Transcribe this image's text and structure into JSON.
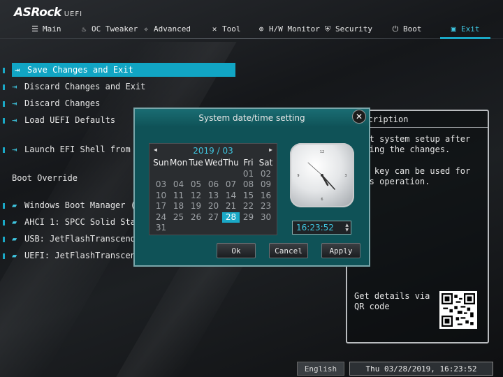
{
  "brand": {
    "name": "ASRock",
    "suffix": "UEFI"
  },
  "nav": {
    "items": [
      {
        "label": "Main",
        "icon": "list-icon"
      },
      {
        "label": "OC Tweaker",
        "icon": "flame-icon"
      },
      {
        "label": "Advanced",
        "icon": "star-icon"
      },
      {
        "label": "Tool",
        "icon": "tools-icon"
      },
      {
        "label": "H/W Monitor",
        "icon": "monitor-icon"
      },
      {
        "label": "Security",
        "icon": "shield-icon"
      },
      {
        "label": "Boot",
        "icon": "power-icon"
      },
      {
        "label": "Exit",
        "icon": "exit-icon",
        "active": true
      }
    ]
  },
  "menu": {
    "items": [
      {
        "label": "Save Changes and Exit",
        "selected": true
      },
      {
        "label": "Discard Changes and Exit"
      },
      {
        "label": "Discard Changes"
      },
      {
        "label": "Load UEFI Defaults"
      },
      {
        "label": "Launch EFI Shell from filesystem device"
      }
    ],
    "boot_override_title": "Boot Override",
    "boot_items": [
      {
        "label": "Windows Boot Manager (SPCC Solid State Disk)"
      },
      {
        "label": "AHCI 1: SPCC Solid State Disk"
      },
      {
        "label": "USB: JetFlashTranscend 8GB 8.07"
      },
      {
        "label": "UEFI: JetFlashTranscend 8GB 8.07"
      }
    ]
  },
  "description": {
    "title": "Description",
    "line1": "Exit system setup after saving the changes.",
    "line2": "F10 key can be used for this operation.",
    "qr_text": "Get details via QR code"
  },
  "dialog": {
    "title": "System date/time setting",
    "close_icon": "close-icon",
    "calendar": {
      "year": "2019",
      "month": "03",
      "weekdays": [
        "Sun",
        "Mon",
        "Tue",
        "Wed",
        "Thu",
        "Fri",
        "Sat"
      ],
      "weeks": [
        [
          "",
          "",
          "",
          "",
          "",
          "01",
          "02"
        ],
        [
          "03",
          "04",
          "05",
          "06",
          "07",
          "08",
          "09"
        ],
        [
          "10",
          "11",
          "12",
          "13",
          "14",
          "15",
          "16"
        ],
        [
          "17",
          "18",
          "19",
          "20",
          "21",
          "22",
          "23"
        ],
        [
          "24",
          "25",
          "26",
          "27",
          "28",
          "29",
          "30"
        ],
        [
          "31",
          "",
          "",
          "",
          "",
          "",
          ""
        ]
      ],
      "selected_day": "28"
    },
    "time": "16:23:52",
    "buttons": {
      "ok": "Ok",
      "cancel": "Cancel",
      "apply": "Apply"
    }
  },
  "status": {
    "language": "English",
    "datetime": "Thu 03/28/2019, 16:23:52"
  },
  "colors": {
    "accent": "#1aa9c7",
    "dialog_bg": "#0f5257"
  }
}
